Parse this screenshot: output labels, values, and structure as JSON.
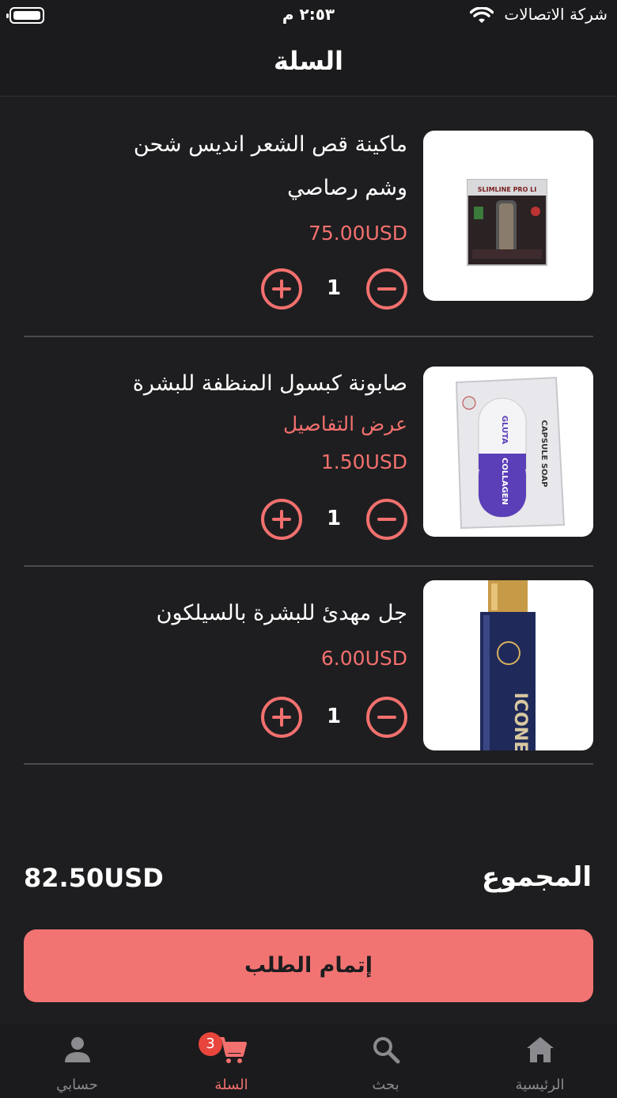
{
  "status_bar": {
    "time": "٢:٥٣ م",
    "carrier": "شركة الاتصالات"
  },
  "header": {
    "title": "السلة"
  },
  "cart": {
    "items": [
      {
        "name_line1": "ماكينة قص الشعر انديس شحن",
        "name_line2": "وشم رصاصي",
        "price": "75.00USD",
        "quantity": "1",
        "image_icon": "hair-clipper-product-image"
      },
      {
        "name_line1": "صابونة كبسول المنظفة للبشرة",
        "details_link": "عرض التفاصيل",
        "price": "1.50USD",
        "quantity": "1",
        "image_icon": "capsule-soap-product-image"
      },
      {
        "name_line1": "جل مهدئ للبشرة بالسيلكون",
        "price": "6.00USD",
        "quantity": "1",
        "image_icon": "silicone-gel-product-image"
      }
    ]
  },
  "summary": {
    "total_label": "المجموع",
    "total_value": "82.50USD"
  },
  "checkout": {
    "label": "إتمام الطلب"
  },
  "tabbar": {
    "tabs": [
      {
        "label": "الرئيسية",
        "icon": "home-icon"
      },
      {
        "label": "بحث",
        "icon": "search-icon"
      },
      {
        "label": "السلة",
        "icon": "cart-icon",
        "badge": "3",
        "active": true
      },
      {
        "label": "حسابي",
        "icon": "person-icon"
      }
    ]
  },
  "colors": {
    "accent": "#f2706e",
    "background": "#1e1e20",
    "badge": "#e8453c"
  }
}
